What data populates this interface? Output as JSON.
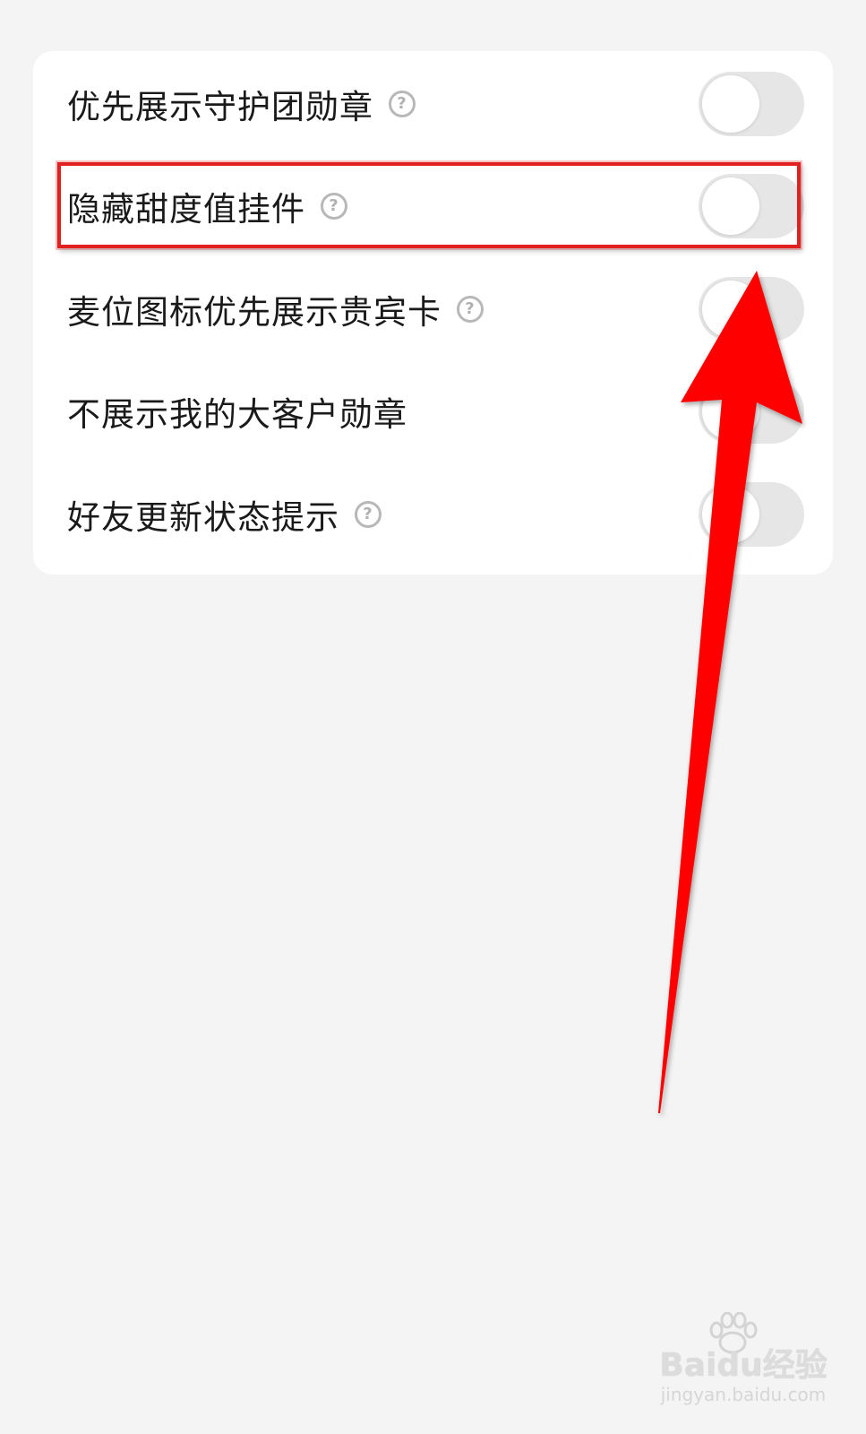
{
  "settings": {
    "items": [
      {
        "label": "优先展示守护团勋章",
        "has_help": true,
        "enabled": false
      },
      {
        "label": "隐藏甜度值挂件",
        "has_help": true,
        "enabled": false
      },
      {
        "label": "麦位图标优先展示贵宾卡",
        "has_help": true,
        "enabled": false
      },
      {
        "label": "不展示我的大客户勋章",
        "has_help": false,
        "enabled": false
      },
      {
        "label": "好友更新状态提示",
        "has_help": true,
        "enabled": false
      }
    ],
    "help_glyph": "?"
  },
  "annotation": {
    "highlight_color": "#e22020",
    "arrow_color": "#ff0000"
  },
  "watermark": {
    "logo": "Baidu经验",
    "url": "jingyan.baidu.com"
  },
  "colors": {
    "background": "#f4f4f4",
    "card": "#ffffff",
    "toggle_off": "#e6e6e6",
    "text": "#1a1a1a"
  }
}
